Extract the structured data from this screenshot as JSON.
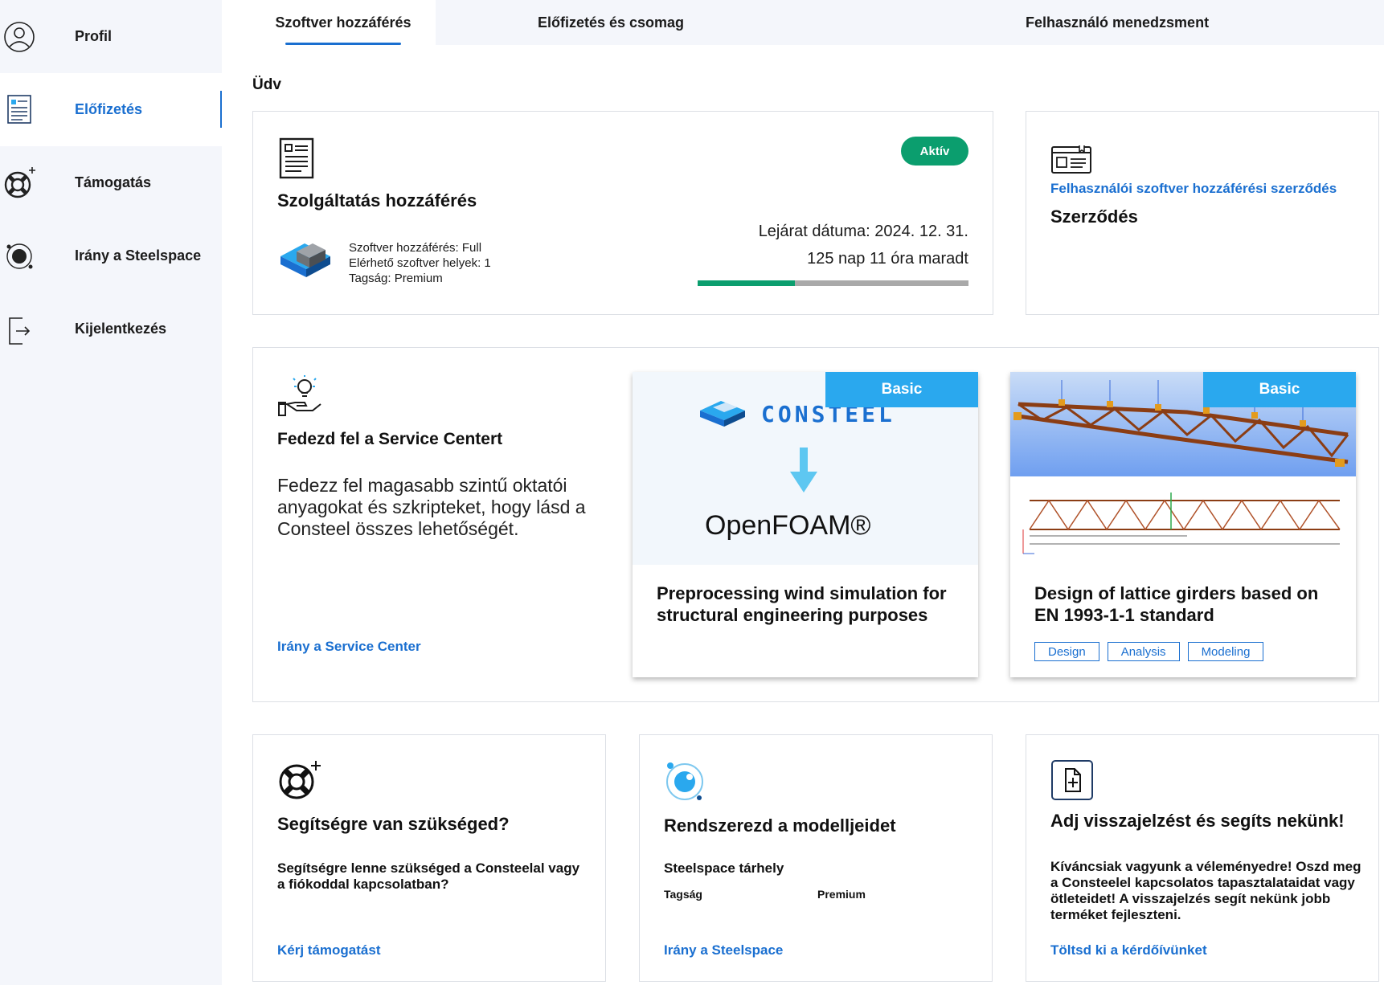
{
  "sidebar": {
    "items": [
      {
        "label": "Profil",
        "icon": "user-circle-icon"
      },
      {
        "label": "Előfizetés",
        "icon": "subscription-document-icon",
        "active": true
      },
      {
        "label": "Támogatás",
        "icon": "lifebuoy-icon"
      },
      {
        "label": "Irány a Steelspace",
        "icon": "steelspace-orbit-icon"
      },
      {
        "label": "Kijelentkezés",
        "icon": "logout-icon"
      }
    ]
  },
  "tabs": [
    {
      "label": "Szoftver hozzáférés",
      "active": true
    },
    {
      "label": "Előfizetés és csomag"
    },
    {
      "label": "Felhasználó menedzsment"
    }
  ],
  "welcome": "Üdv",
  "access_card": {
    "title": "Szolgáltatás hozzáférés",
    "status": "Aktív",
    "details": [
      "Szoftver hozzáférés: Full",
      "Elérhető szoftver helyek: 1",
      "Tagság: Premium"
    ],
    "expiry": "Lejárat dátuma: 2024. 12. 31.",
    "remaining": "125 nap 11 óra maradt",
    "progress_elapsed_fraction": 0.36,
    "accent": "#0b9e6e"
  },
  "contract_card": {
    "link": "Felhasználói szoftver hozzáférési szerződés",
    "title": "Szerződés"
  },
  "service_center": {
    "title": "Fedezd fel a Service Centert",
    "description": "Fedezz fel magasabb szintű oktatói anyagokat és szkripteket, hogy lásd a Consteel összes lehetőségét.",
    "link": "Irány a Service Center",
    "tiles": [
      {
        "badge": "Basic",
        "logo_top": "CONSTEEL",
        "logo_bottom": "OpenFOAM®",
        "title": "Preprocessing wind simulation for structural engineering purposes",
        "tags": []
      },
      {
        "badge": "Basic",
        "title": "Design of lattice girders based on EN 1993-1-1 standard",
        "tags": [
          "Design",
          "Analysis",
          "Modeling"
        ]
      }
    ]
  },
  "help_card": {
    "title": "Segítségre van szükséged?",
    "description": "Segítségre lenne szükséged a Consteelal vagy a fiókoddal kapcsolatban?",
    "link": "Kérj támogatást"
  },
  "models_card": {
    "title": "Rendszerezd a modelljeidet",
    "subtitle": "Steelspace tárhely",
    "membership_label": "Tagság",
    "membership_value": "Premium",
    "link": "Irány a Steelspace"
  },
  "feedback_card": {
    "title": "Adj visszajelzést és segíts nekünk!",
    "description": "Kíváncsiak vagyunk a véleményedre! Oszd meg a Consteelel kapcsolatos tapasztalataidat vagy ötleteidet! A visszajelzés segít nekünk jobb terméket fejleszteni.",
    "link": "Töltsd ki a kérdőívünket"
  },
  "colors": {
    "link": "#1a6fd0",
    "sidebar_bg": "#f4f6fb",
    "badge_blue": "#2aa8ee"
  }
}
